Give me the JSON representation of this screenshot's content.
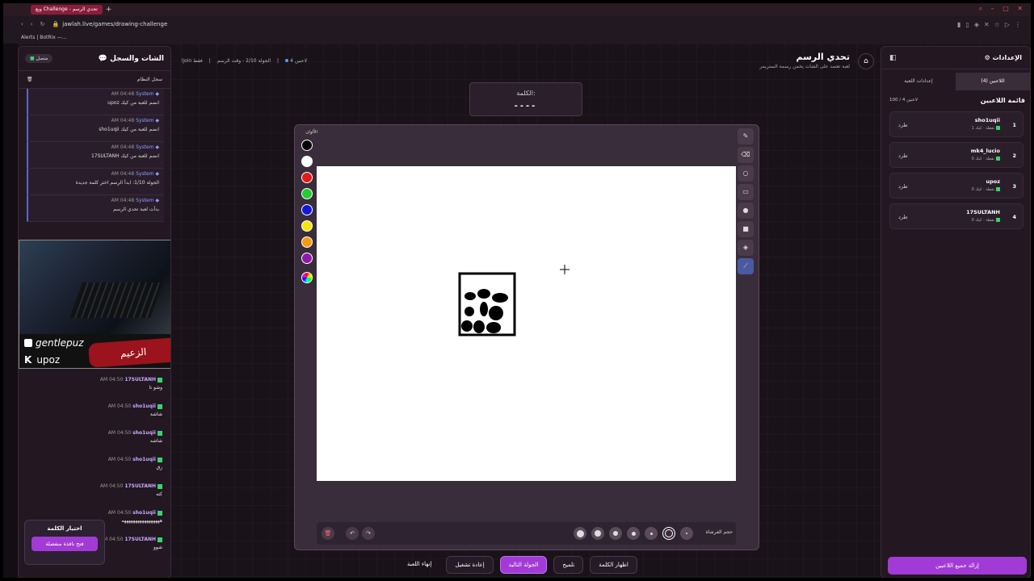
{
  "browser": {
    "tab_title": "ويع Challenge - تحدي الرسم",
    "url": "jawlah.live/games/drawing-challenge",
    "bookmark": "Alerts | BotRix —..."
  },
  "chat": {
    "title": "الشات والسجل",
    "status": "متصل",
    "system_log_label": "سجل النظام",
    "system_messages": [
      {
        "user": "System",
        "time": "AM 04:48",
        "text": "upoz انضم للعبة من كيك"
      },
      {
        "user": "System",
        "time": "AM 04:48",
        "text": "sho1uqii انضم للعبة من كيك"
      },
      {
        "user": "System",
        "time": "AM 04:48",
        "text": "17SULTANH انضم للعبة من كيك"
      },
      {
        "user": "System",
        "time": "AM 04:48",
        "text": "الجولة 1/10: ابدأ الرسم اختر كلمة جديدة"
      },
      {
        "user": "System",
        "time": "AM 04:48",
        "text": "بدأت لعبة تحدي الرسم"
      }
    ],
    "cam_handle_tiktok": "gentlepuz",
    "cam_handle_kick": "upoz",
    "cam_overlay": "الزعيم",
    "messages": [
      {
        "user": "17SULTANH",
        "time": "AM 04:50",
        "text": "وشو تا"
      },
      {
        "user": "sho1uqii",
        "time": "AM 04:50",
        "text": "شاشة"
      },
      {
        "user": "sho1uqii",
        "time": "AM 04:50",
        "text": "شاشه"
      },
      {
        "user": "sho1uqii",
        "time": "AM 04:50",
        "text": "زق"
      },
      {
        "user": "17SULTANH",
        "time": "AM 04:50",
        "text": "كته"
      },
      {
        "user": "sho1uqii",
        "time": "AM 04:50",
        "text": "هههههههههههههههههه"
      },
      {
        "user": "17SULTANH",
        "time": "AM 04:50",
        "text": "شوو"
      }
    ],
    "word_choice_title": "اختيار الكلمة",
    "word_choice_button": "فتح نافذة منفصلة"
  },
  "header": {
    "players_count": "4 لاعبين",
    "round_info": "الجولة 2/10 - وقت الرسم",
    "join_hint": "!join فقط",
    "title": "تحدي الرسم",
    "subtitle": "لعبة تعتمد على الشات يخمن رسمة الستريمر"
  },
  "word": {
    "label": "الكلمة:",
    "value": "----"
  },
  "board": {
    "colors_label": "الألوان",
    "colors": [
      "#000000",
      "#ffffff",
      "#e01b1b",
      "#22cc33",
      "#1616d6",
      "#f5e50a",
      "#f39c12",
      "#8e1aa8"
    ],
    "brush_size_label": "حجم الفرشاة"
  },
  "controls": {
    "end_game": "إنهاء اللعبة",
    "restart": "إعادة تشغيل",
    "next_round": "الجولة التالية",
    "hint": "تلميح",
    "show_word": "اظهار الكلمة"
  },
  "settings": {
    "title": "الإعدادات",
    "tab_players": "اللاعبين (4)",
    "tab_game": "إعدادات اللعبة",
    "players_list_title": "قائمة اللاعبين",
    "players_count": "100 / 4 لاعبين",
    "kick_label": "طرد",
    "players": [
      {
        "rank": "1",
        "name": "sho1uqii",
        "platform": "كيك",
        "points": "1 نقطة"
      },
      {
        "rank": "2",
        "name": "mk4_lucio",
        "platform": "كيك",
        "points": "0 نقطة"
      },
      {
        "rank": "3",
        "name": "upoz",
        "platform": "كيك",
        "points": "0 نقطة"
      },
      {
        "rank": "4",
        "name": "17SULTANH",
        "platform": "كيك",
        "points": "0 نقطة"
      }
    ],
    "remove_all": "إزالة جميع اللاعبين"
  }
}
